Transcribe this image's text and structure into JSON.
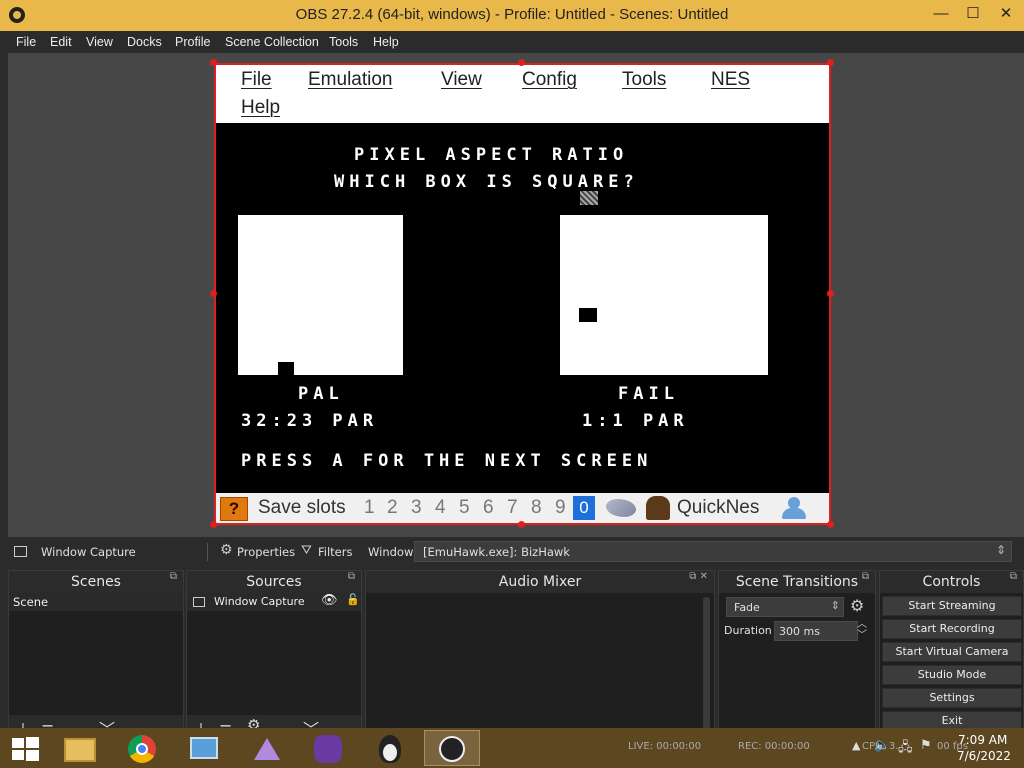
{
  "window": {
    "title": "OBS 27.2.4 (64-bit, windows) - Profile: Untitled - Scenes: Untitled",
    "minimize": "—",
    "maximize": "☐",
    "close": "✕"
  },
  "menu": [
    "File",
    "Edit",
    "View",
    "Docks",
    "Profile",
    "Scene Collection",
    "Tools",
    "Help"
  ],
  "emulator": {
    "menu": [
      "File",
      "Emulation",
      "View",
      "Config",
      "Tools",
      "NES",
      "Help"
    ],
    "screen": {
      "title1": "PIXEL ASPECT RATIO",
      "title2": "WHICH BOX IS SQUARE?",
      "left_label": "PAL",
      "left_ratio": "32:23 PAR",
      "right_label": "FAIL",
      "right_ratio": "1:1 PAR",
      "footer": "PRESS A FOR THE NEXT SCREEN"
    },
    "status": {
      "save_slots_label": "Save slots",
      "slots": [
        "1",
        "2",
        "3",
        "4",
        "5",
        "6",
        "7",
        "8",
        "9",
        "0"
      ],
      "selected_slot": "0",
      "core": "QuickNes"
    }
  },
  "source_bar": {
    "source": "Window Capture",
    "properties": "Properties",
    "filters": "Filters",
    "window_label": "Window",
    "window_value": "[EmuHawk.exe]: BizHawk"
  },
  "docks": {
    "scenes": {
      "title": "Scenes",
      "items": [
        "Scene"
      ]
    },
    "sources": {
      "title": "Sources",
      "items": [
        "Window Capture"
      ]
    },
    "mixer": {
      "title": "Audio Mixer"
    },
    "transitions": {
      "title": "Scene Transitions",
      "type": "Fade",
      "duration_label": "Duration",
      "duration_value": "300 ms"
    },
    "controls": {
      "title": "Controls",
      "buttons": [
        "Start Streaming",
        "Start Recording",
        "Start Virtual Camera",
        "Studio Mode",
        "Settings",
        "Exit"
      ]
    }
  },
  "statusbar": {
    "live": "LIVE: 00:00:00",
    "rec": "REC: 00:00:00",
    "cpu": "CPU: 3.",
    "fps": "00 fps"
  },
  "clock": {
    "time": "7:09 AM",
    "date": "7/6/2022"
  },
  "colors": {
    "title_bar": "#e8b84a",
    "selection_border": "#e0201e",
    "dock_bg": "#1f1f1f",
    "taskbar": "#5d4721",
    "slot_highlight": "#1e6fd9"
  }
}
